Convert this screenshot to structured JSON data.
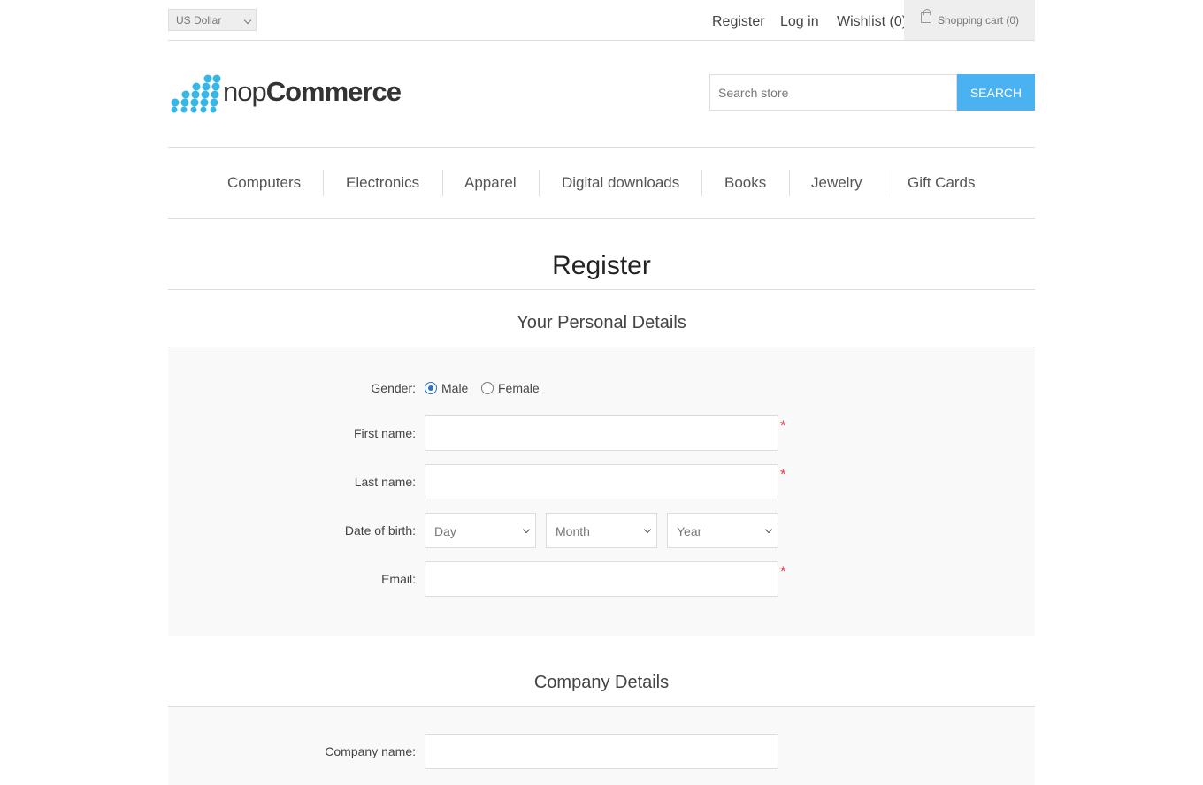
{
  "header": {
    "currency": "US Dollar",
    "links": {
      "register": "Register",
      "login": "Log in",
      "wishlist": "Wishlist (0)",
      "cart": "Shopping cart (0)"
    },
    "logo": {
      "part1": "nop",
      "part2": "Commerce"
    },
    "search": {
      "placeholder": "Search store",
      "button": "Search"
    }
  },
  "menu": [
    "Computers",
    "Electronics",
    "Apparel",
    "Digital downloads",
    "Books",
    "Jewelry",
    "Gift Cards"
  ],
  "page": {
    "title": "Register",
    "personal": {
      "title": "Your Personal Details",
      "gender_label": "Gender:",
      "male": "Male",
      "female": "Female",
      "selected_gender": "Male",
      "first_name_label": "First name:",
      "last_name_label": "Last name:",
      "dob_label": "Date of birth:",
      "day": "Day",
      "month": "Month",
      "year": "Year",
      "email_label": "Email:",
      "required_mark": "*"
    },
    "company": {
      "title": "Company Details",
      "company_name_label": "Company name:"
    }
  },
  "colors": {
    "accent": "#4ab2f1",
    "required": "#e4434b",
    "logo_dots": "#37b7e7"
  }
}
